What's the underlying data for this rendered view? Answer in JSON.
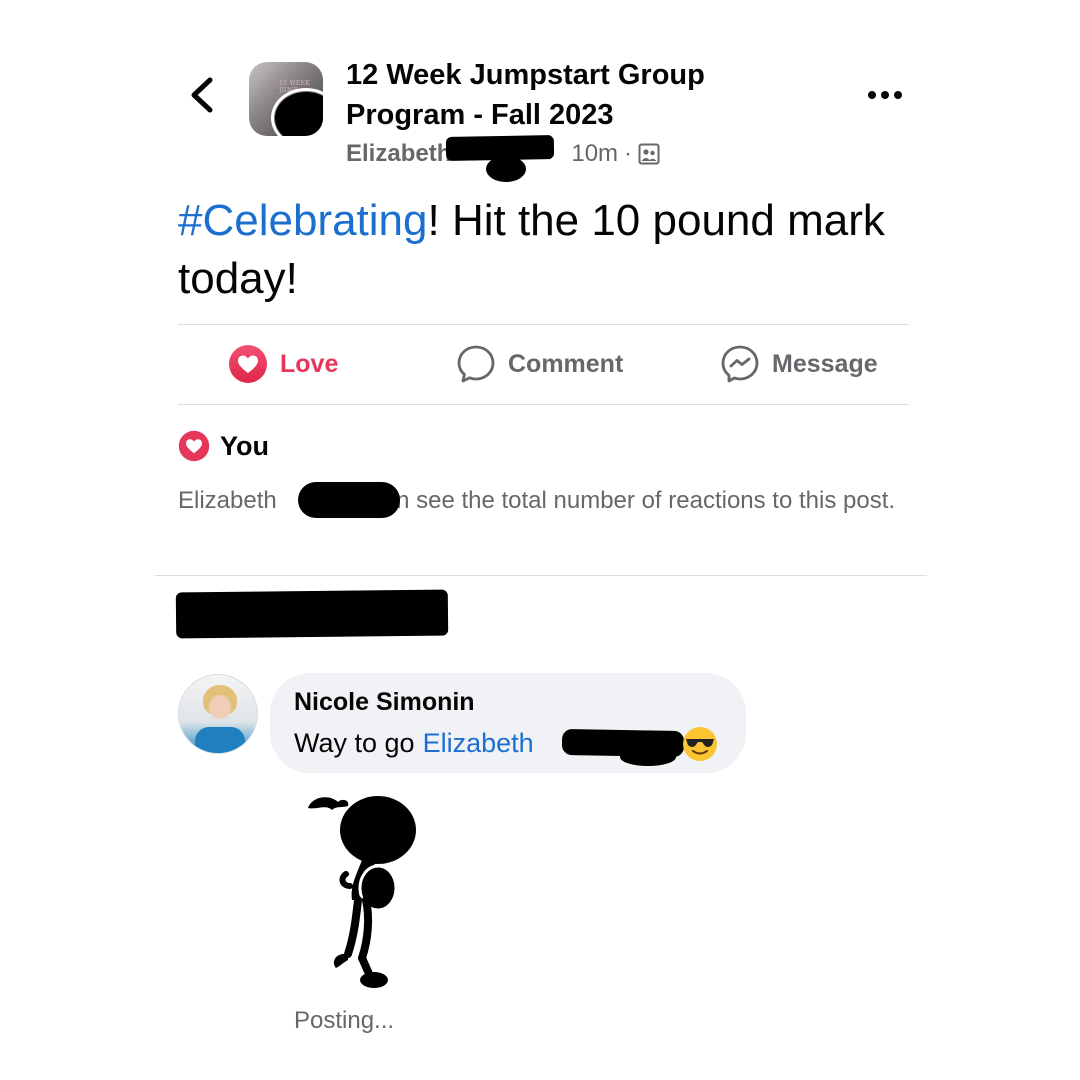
{
  "header": {
    "title": "12 Week Jumpstart Group Program - Fall 2023",
    "author": "Elizabeth",
    "time": "10m",
    "separator": "·",
    "icons": {
      "back": "chevron-left-icon",
      "more": "more-dots-icon",
      "audience": "group-audience-icon"
    }
  },
  "post": {
    "hashtag": "#Celebrating",
    "text": "!  Hit the 10 pound mark today!"
  },
  "actions": {
    "love": "Love",
    "comment": "Comment",
    "message": "Message"
  },
  "reactions": {
    "who": "You",
    "note_prefix": "Elizabeth",
    "note_suffix": "an see the total number of reactions to this post."
  },
  "comment": {
    "author": "Nicole Simonin",
    "text": "Way to go",
    "mention": "Elizabeth",
    "emoji": "😎",
    "status": "Posting..."
  },
  "colors": {
    "love": "#e6365a",
    "link": "#1b70cf",
    "muted": "#65676b",
    "bubble": "#f0f2f5",
    "divider": "#dadde1"
  }
}
